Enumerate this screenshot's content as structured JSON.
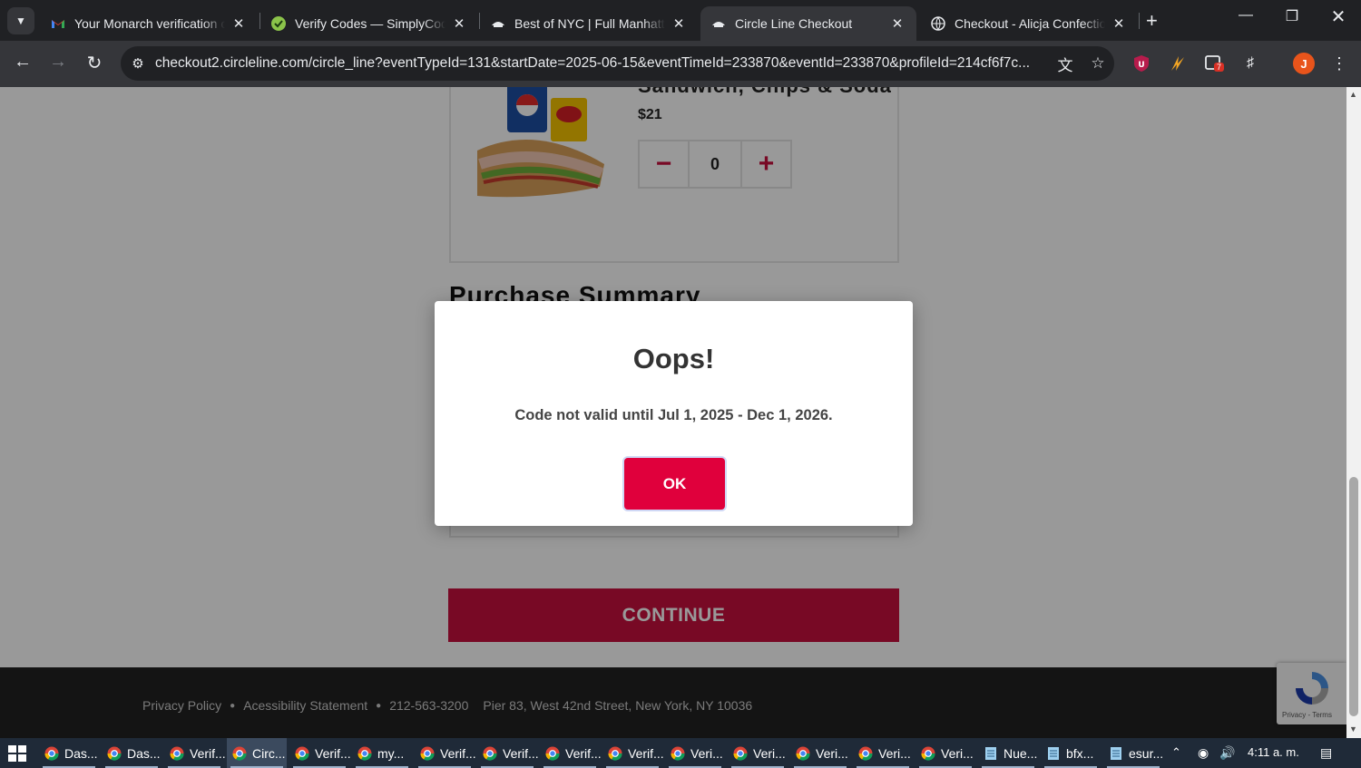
{
  "browser": {
    "tabs": [
      {
        "title": "Your Monarch verification co",
        "icon": "gmail-icon",
        "active": false
      },
      {
        "title": "Verify Codes — SimplyCodes",
        "icon": "simplycodes-icon",
        "active": false
      },
      {
        "title": "Best of NYC | Full Manhattan",
        "icon": "circleline-icon",
        "active": false
      },
      {
        "title": "Circle Line Checkout",
        "icon": "circleline-icon",
        "active": true
      },
      {
        "title": "Checkout - Alicja Confection",
        "icon": "globe-icon",
        "active": false
      }
    ],
    "url": "checkout2.circleline.com/circle_line?eventTypeId=131&startDate=2025-06-15&eventTimeId=233870&eventId=233870&profileId=214cf6f7c...",
    "extension_badge": "7",
    "profile_initial": "J"
  },
  "product": {
    "name": "Sandwich, Chips & Soda",
    "price": "$21",
    "quantity": "0",
    "minus": "−",
    "plus": "+"
  },
  "summary": {
    "title": "Purchase Summary"
  },
  "continue_label": "CONTINUE",
  "footer": {
    "privacy": "Privacy Policy",
    "accessibility": "Acessibility Statement",
    "phone": "212-563-3200",
    "address": "Pier 83, West 42nd Street, New York, NY 10036"
  },
  "recaptcha": {
    "terms": "Privacy - Terms"
  },
  "modal": {
    "title": "Oops!",
    "message": "Code not valid until Jul 1, 2025 - Dec 1, 2026.",
    "ok_label": "OK"
  },
  "taskbar": {
    "items": [
      {
        "label": "Das..."
      },
      {
        "label": "Das..."
      },
      {
        "label": "Verif..."
      },
      {
        "label": "Circ...",
        "active": true
      },
      {
        "label": "Verif..."
      },
      {
        "label": "my..."
      },
      {
        "label": "Verif..."
      },
      {
        "label": "Verif..."
      },
      {
        "label": "Verif..."
      },
      {
        "label": "Verif..."
      },
      {
        "label": "Veri..."
      },
      {
        "label": "Veri..."
      },
      {
        "label": "Veri..."
      },
      {
        "label": "Veri..."
      },
      {
        "label": "Veri..."
      },
      {
        "label": "Nue..."
      },
      {
        "label": "bfx..."
      },
      {
        "label": "esur..."
      }
    ],
    "clock": "4:11 a. m."
  },
  "colors": {
    "brand_red": "#c8103e",
    "ok_red": "#e0003c",
    "footer_bg": "#222222"
  }
}
